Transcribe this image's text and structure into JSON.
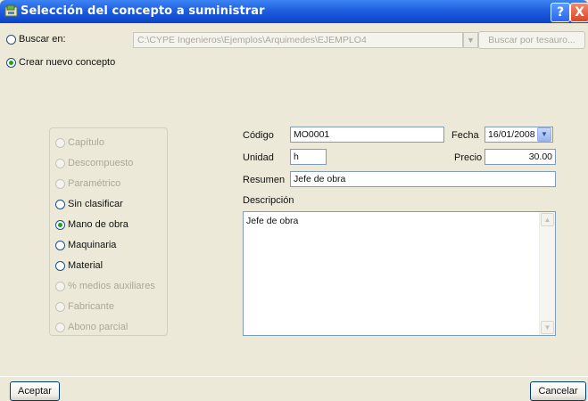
{
  "window": {
    "title": "Selección del concepto a suministrar",
    "help_label": "?",
    "close_label": "X",
    "titlebar_color": "#0a44c8"
  },
  "source": {
    "buscar_label": "Buscar en:",
    "path_value": "C:\\CYPE Ingenieros\\Ejemplos\\Arquimedes\\EJEMPLO4",
    "buscar_tesauro_label": "Buscar por tesauro...",
    "crear_label": "Crear nuevo concepto",
    "selected": "crear"
  },
  "concept_types": [
    {
      "label": "Capítulo",
      "enabled": false,
      "checked": false
    },
    {
      "label": "Descompuesto",
      "enabled": false,
      "checked": false
    },
    {
      "label": "Paramétrico",
      "enabled": false,
      "checked": false
    },
    {
      "label": "Sin clasificar",
      "enabled": true,
      "checked": false
    },
    {
      "label": "Mano de obra",
      "enabled": true,
      "checked": true
    },
    {
      "label": "Maquinaria",
      "enabled": true,
      "checked": false
    },
    {
      "label": "Material",
      "enabled": true,
      "checked": false
    },
    {
      "label": "% medios auxiliares",
      "enabled": false,
      "checked": false
    },
    {
      "label": "Fabricante",
      "enabled": false,
      "checked": false
    },
    {
      "label": "Abono parcial",
      "enabled": false,
      "checked": false
    }
  ],
  "form": {
    "codigo_label": "Código",
    "codigo_value": "MO0001",
    "fecha_label": "Fecha",
    "fecha_value": "16/01/2008",
    "unidad_label": "Unidad",
    "unidad_value": "h",
    "precio_label": "Precio",
    "precio_value": "30.00",
    "resumen_label": "Resumen",
    "resumen_value": "Jefe de obra",
    "descripcion_label": "Descripción",
    "descripcion_value": "Jefe de obra"
  },
  "footer": {
    "aceptar_label": "Aceptar",
    "cancelar_label": "Cancelar"
  }
}
